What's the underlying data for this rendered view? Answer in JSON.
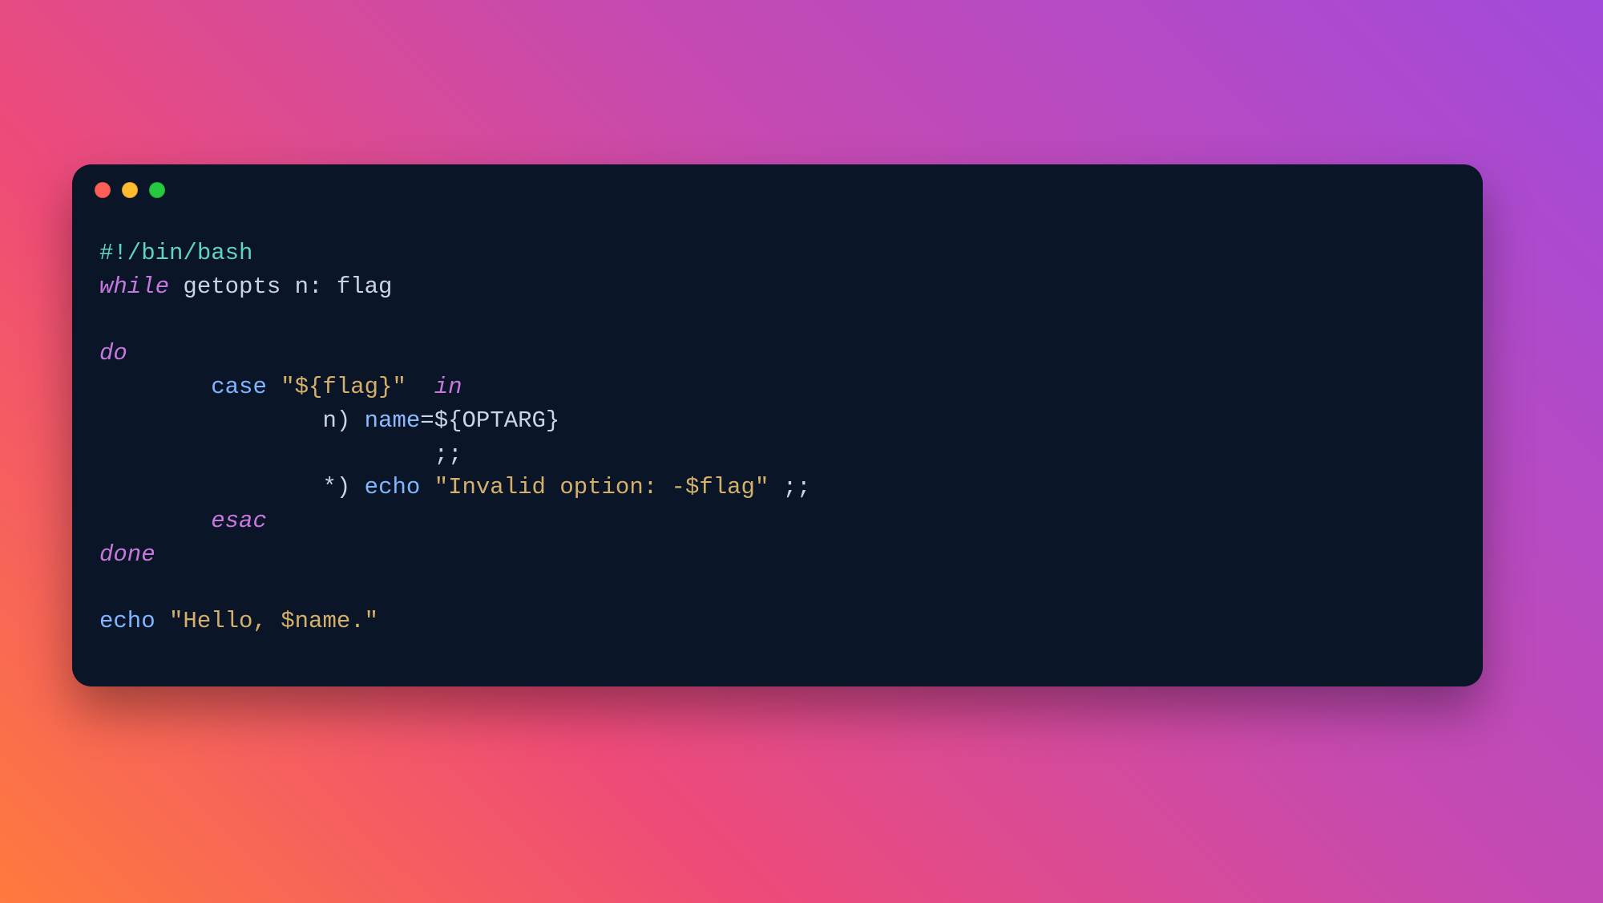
{
  "window": {
    "traffic_lights": [
      "red",
      "yellow",
      "green"
    ]
  },
  "code": {
    "shebang": "#!/bin/bash",
    "kw_while": "while",
    "txt_getopts": " getopts n: flag",
    "kw_do": "do",
    "indent8": "        ",
    "indent16": "                ",
    "indent24": "                        ",
    "txt_case": "case ",
    "str_flag": "\"${flag}\"",
    "sp2": "  ",
    "kw_in": "in",
    "txt_n_pattern": "n) ",
    "txt_name_assign": "name",
    "txt_eq": "=",
    "txt_optarg": "${OPTARG}",
    "txt_dsemi": ";;",
    "txt_star_pattern": "*) ",
    "txt_echo": "echo ",
    "str_invalid": "\"Invalid option: -$flag\"",
    "sp_dsemi": " ;;",
    "kw_esac": "esac",
    "kw_done": "done",
    "txt_echo2": "echo ",
    "str_hello": "\"Hello, $name.\""
  }
}
